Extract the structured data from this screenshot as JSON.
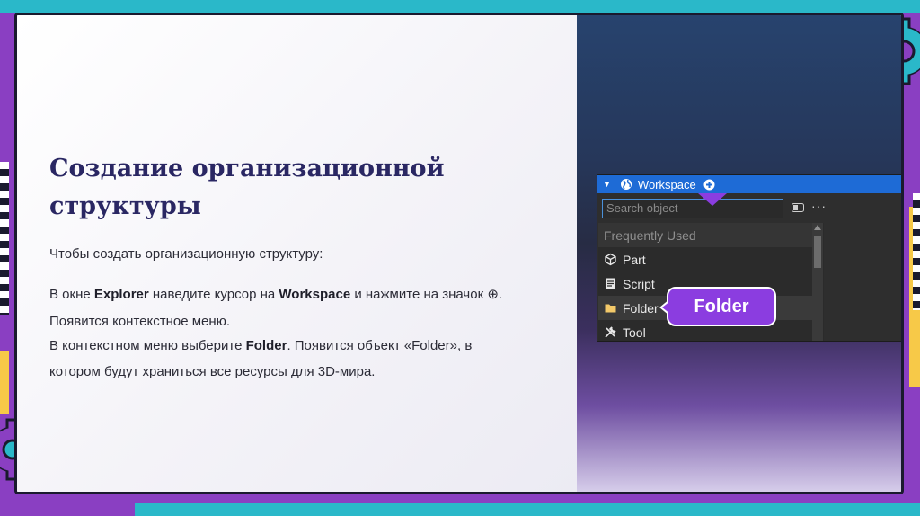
{
  "slide": {
    "title": "Создание организационной структуры",
    "intro": "Чтобы создать организационную структуру:",
    "p1": {
      "t1": "В окне ",
      "b1": "Explorer",
      "t2": " наведите курсор на ",
      "b2": "Workspace",
      "t3": " и нажмите на значок ",
      "glyph": "⊕",
      "t4": "."
    },
    "p2": "Появится контекстное меню.",
    "p3": {
      "t1": "В контекстном меню выберите ",
      "b1": "Folder",
      "t2": ". Появится объект «Folder», в"
    },
    "p4": "котором будут храниться все ресурсы для 3D-мира."
  },
  "explorer": {
    "workspace_label": "Workspace",
    "search_placeholder": "Search object",
    "more_glyph": "···",
    "items": [
      {
        "label": "Frequently Used",
        "icon": "none"
      },
      {
        "label": "Part",
        "icon": "cube-icon"
      },
      {
        "label": "Script",
        "icon": "script-icon"
      },
      {
        "label": "Folder",
        "icon": "folder-icon"
      },
      {
        "label": "Tool",
        "icon": "tool-icon"
      }
    ],
    "callout_label": "Folder"
  },
  "colors": {
    "title": "#2a2763",
    "accent_purple": "#8b3de0",
    "workspace_blue": "#1e6bd6",
    "frame_purple": "#8a3fc2",
    "frame_teal": "#2ab8c9",
    "frame_yellow": "#f7c948"
  }
}
